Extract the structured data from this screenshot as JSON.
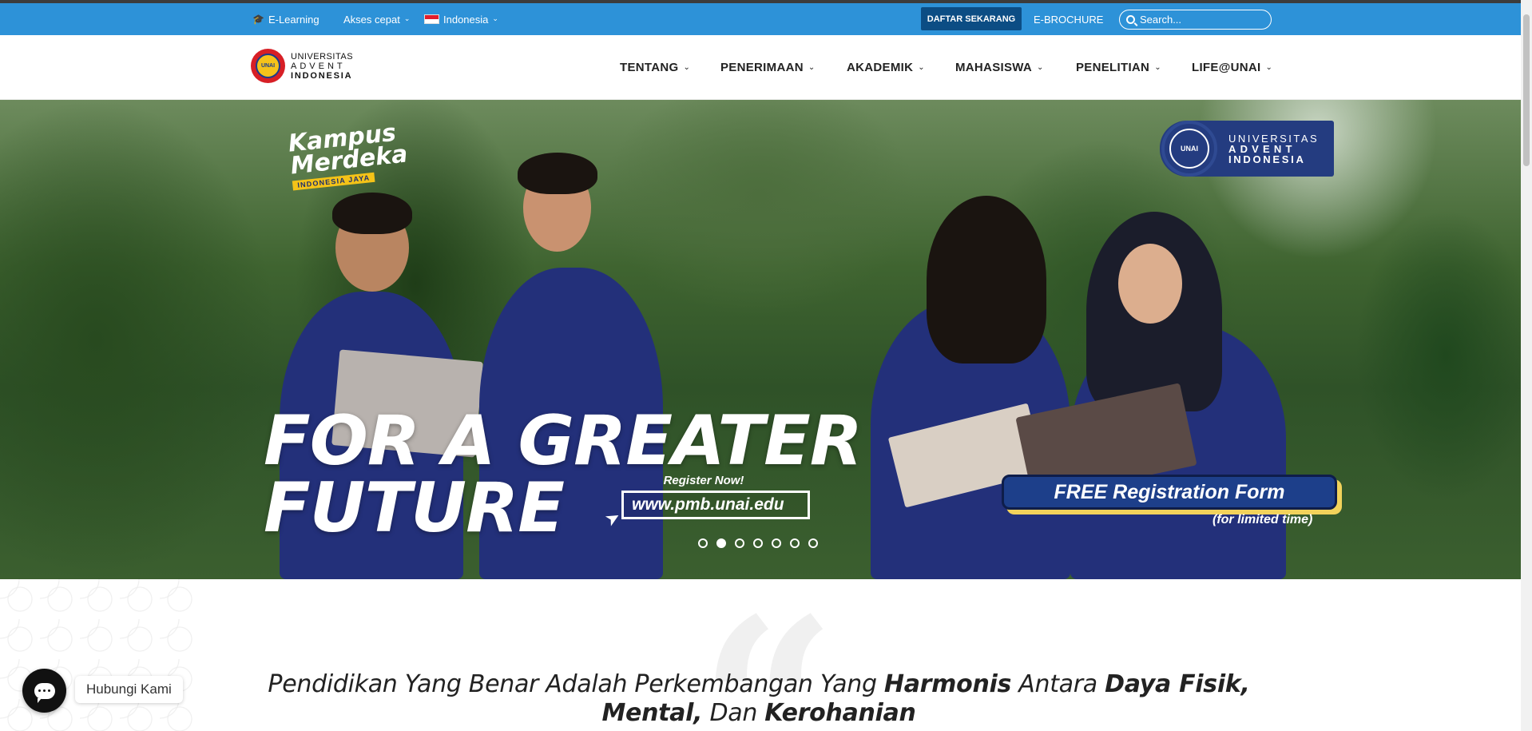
{
  "topbar": {
    "elearning": "E-Learning",
    "akses_cepat": "Akses cepat",
    "language": "Indonesia",
    "daftar": "DAFTAR SEKARANG",
    "ebrochure": "E-BROCHURE",
    "search_placeholder": "Search..."
  },
  "logo": {
    "line1": "UNIVERSITAS",
    "line2": "ADVENT",
    "line3": "INDONESIA"
  },
  "nav": [
    {
      "label": "TENTANG"
    },
    {
      "label": "PENERIMAAN"
    },
    {
      "label": "AKADEMIK"
    },
    {
      "label": "MAHASISWA"
    },
    {
      "label": "PENELITIAN"
    },
    {
      "label": "LIFE@UNAI"
    }
  ],
  "hero": {
    "kampus_line1": "Kampus",
    "kampus_line2": "Merdeka",
    "kampus_tag": "INDONESIA JAYA",
    "badge_line1": "UNIVERSITAS",
    "badge_line2": "ADVENT",
    "badge_line3": "INDONESIA",
    "headline_line1": "FOR A GREATER",
    "headline_line2": "FUTURE",
    "register_now": "Register Now!",
    "register_url": "www.pmb.unai.edu",
    "free_form": "FREE Registration Form",
    "limited": "(for limited time)",
    "slide_count": 7,
    "active_slide": 2
  },
  "quote": {
    "mark": "“",
    "p1": "Pendidikan Yang Benar Adalah Perkembangan Yang ",
    "b1": "Harmonis",
    "p2": " Antara ",
    "b2": "Daya Fisik,",
    "b3": "Mental,",
    "p3": " Dan ",
    "b4": "Kerohanian"
  },
  "chat": {
    "label": "Hubungi Kami"
  },
  "colors": {
    "topbar": "#2d92d8",
    "daftar_button": "#0c4d84",
    "badge": "#243c80"
  }
}
